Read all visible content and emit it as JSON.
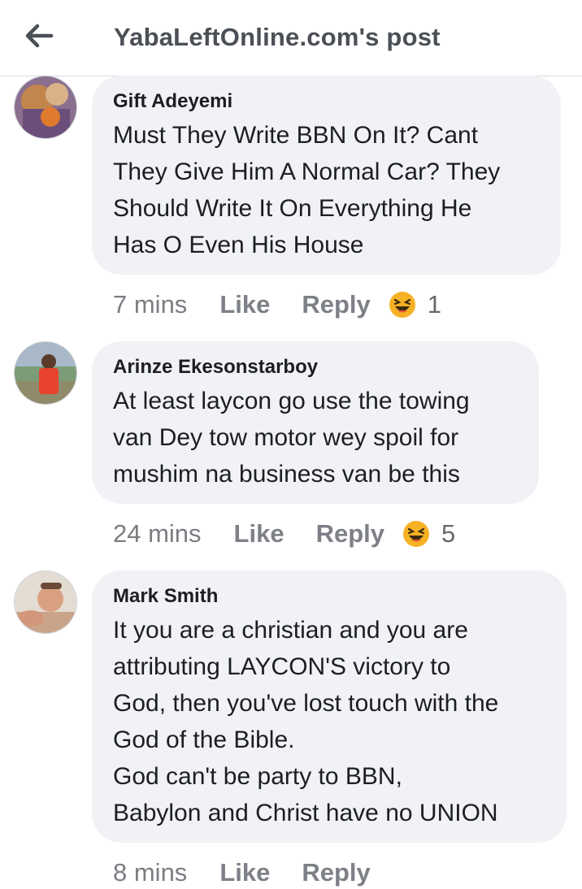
{
  "header": {
    "title": "YabaLeftOnline.com's post",
    "back_icon": "arrow-left-icon"
  },
  "comments": [
    {
      "author": "Gift Adeyemi",
      "text": "Must They Write BBN On It? Cant\nThey Give Him A Normal Car? They\nShould Write It On Everything He\nHas O Even His House",
      "time": "7 mins",
      "like_label": "Like",
      "reply_label": "Reply",
      "reaction_icon": "laughing-emoji-icon",
      "reaction_count": "1"
    },
    {
      "author": "Arinze Ekesonstarboy",
      "text": "At least laycon go use the towing\nvan Dey tow motor wey spoil for\nmushim na business van be this",
      "time": "24 mins",
      "like_label": "Like",
      "reply_label": "Reply",
      "reaction_icon": "laughing-emoji-icon",
      "reaction_count": "5"
    },
    {
      "author": "Mark Smith",
      "text": "It you are a christian and you are\nattributing LAYCON'S victory to\nGod, then you've lost touch with the\nGod of the Bible.\nGod can't be party to BBN,\nBabylon and Christ have no UNION",
      "time": "8 mins",
      "like_label": "Like",
      "reply_label": "Reply"
    }
  ],
  "colors": {
    "bubble": "#f0f2f5",
    "meta_text": "#65676b",
    "emoji_face": "#f7b125"
  }
}
